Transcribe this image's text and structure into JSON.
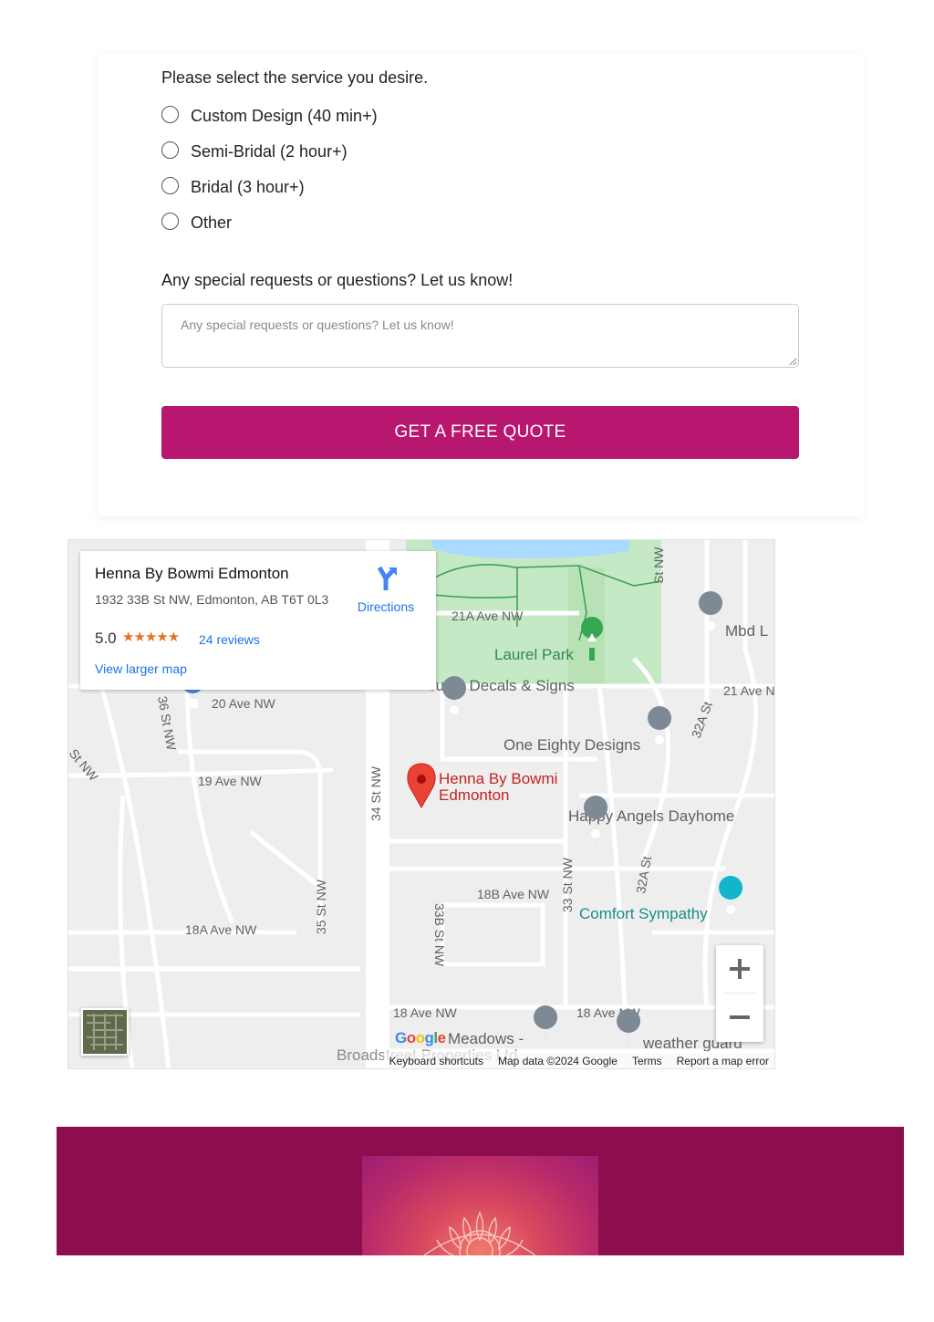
{
  "form": {
    "service_question": "Please select the service you desire.",
    "services": [
      "Custom Design (40 min+)",
      "Semi-Bridal (2 hour+)",
      "Bridal (3 hour+)",
      "Other"
    ],
    "requests_label": "Any special requests or questions? Let us know!",
    "requests_placeholder": "Any special requests or questions? Let us know!",
    "submit_label": "GET A FREE QUOTE"
  },
  "map": {
    "place_name": "Henna By Bowmi Edmonton",
    "address": "1932 33B St NW, Edmonton, AB T6T 0L3",
    "rating": "5.0",
    "stars": "★★★★★",
    "reviews_link": "24 reviews",
    "larger_map_link": "View larger map",
    "directions_label": "Directions",
    "pin_label_line1": "Henna By Bowmi",
    "pin_label_line2": "Edmonton",
    "streets": {
      "ave_21a": "21A Ave NW",
      "ave_21": "21 Ave N",
      "ave_20": "20 Ave NW",
      "ave_19": "19 Ave NW",
      "ave_18b": "18B Ave NW",
      "ave_18a": "18A Ave NW",
      "ave_18_left": "18 Ave NW",
      "ave_18_right": "18 Ave NW",
      "st_34": "34 St NW",
      "st_36": "36 St NW",
      "st_35": "35 St NW",
      "st_33b": "33B St NW",
      "st_33": "33 St NW",
      "st_32a_top": "32A St",
      "st_32a_bottom": "32A St",
      "st_top": "St NW",
      "st_left": "St NW"
    },
    "pois": {
      "laurel_park": "Laurel Park",
      "decals": "rucut Decals & Signs",
      "one_eighty": "One Eighty Designs",
      "happy_angels": "Happy Angels Dayhome",
      "comfort": "Comfort Sympathy",
      "mbd": "Mbd L",
      "meadows": "Meadows -",
      "weather": "weather guard",
      "broad": "Broadstreet Properties Ltd"
    },
    "google_logo": "Google",
    "attribution": {
      "shortcuts": "Keyboard shortcuts",
      "map_data": "Map data ©2024 Google",
      "terms": "Terms",
      "report": "Report a map error"
    }
  },
  "colors": {
    "accent": "#b8176f",
    "footer": "#8c0e4e",
    "link": "#1a73e8",
    "pin": "#ea4335",
    "star": "#e7711b"
  }
}
